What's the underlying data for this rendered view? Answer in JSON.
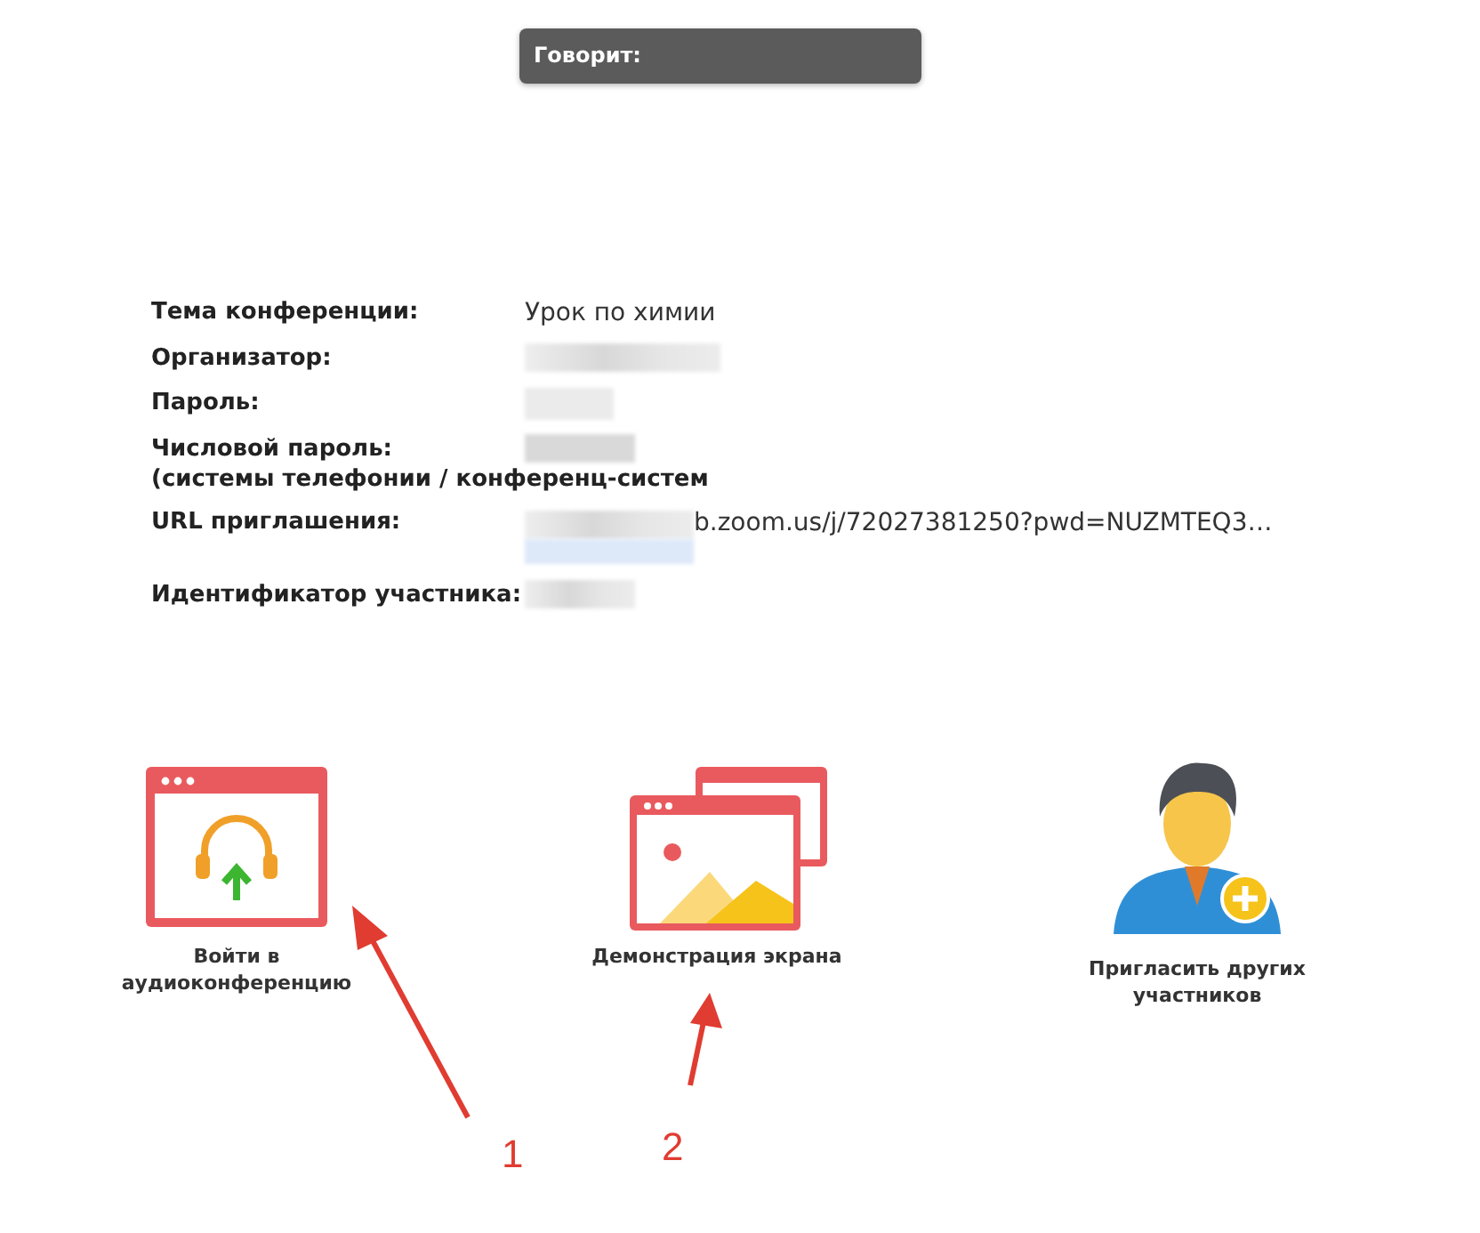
{
  "speaker_bar": {
    "label": "Говорит:"
  },
  "details": [
    {
      "label": "Тема конференции:",
      "value": "Урок по химии",
      "redacted": false
    },
    {
      "label": "Организатор:",
      "redacted": true
    },
    {
      "label": "Пароль:",
      "redacted": true
    },
    {
      "label": "Числовой пароль:",
      "note": "(системы телефонии / конференц-систем",
      "redacted": true
    },
    {
      "label": "URL приглашения:",
      "value": "b.zoom.us/j/72027381250?pwd=NUZMTEQ3…",
      "redacted": true,
      "kind": "link"
    },
    {
      "label": "Идентификатор участника:",
      "redacted": true
    }
  ],
  "actions": [
    {
      "kind": "audio",
      "label": "Войти в аудиоконференцию"
    },
    {
      "kind": "share",
      "label": "Демонстрация экрана"
    },
    {
      "kind": "invite",
      "label": "Пригласить других участников"
    }
  ],
  "annotations": [
    {
      "number": "1"
    },
    {
      "number": "2"
    }
  ]
}
